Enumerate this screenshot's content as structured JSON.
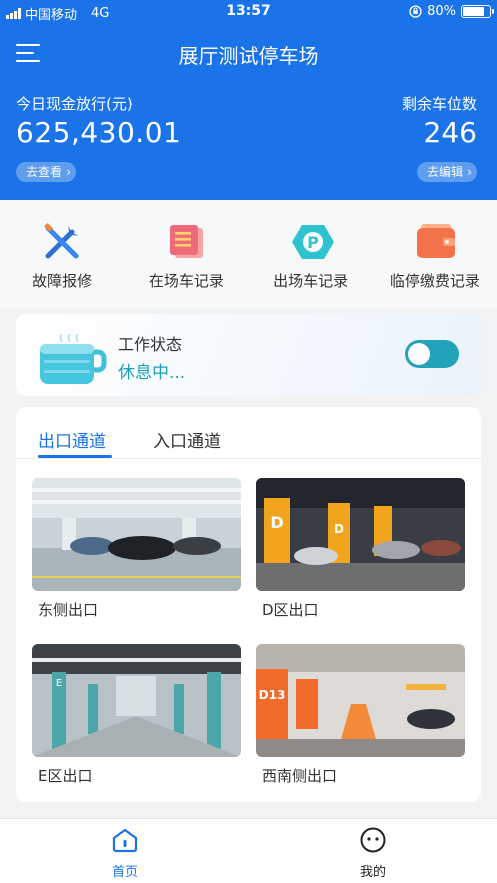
{
  "status_bar": {
    "carrier": "中国移动",
    "network": "4G",
    "time": "13:57",
    "battery": "80%",
    "battery_level": 0.8
  },
  "header": {
    "title": "展厅测试停车场"
  },
  "cash": {
    "label": "今日现金放行(元)",
    "value": "625,430.01",
    "link": "去查看"
  },
  "spots": {
    "label": "剩余车位数",
    "value": "246",
    "link": "去编辑"
  },
  "quick_actions": [
    {
      "label": "故障报修",
      "icon": "wrench-screwdriver-icon"
    },
    {
      "label": "在场车记录",
      "icon": "in-lot-record-icon"
    },
    {
      "label": "出场车记录",
      "icon": "parking-exit-icon"
    },
    {
      "label": "临停缴费记录",
      "icon": "wallet-icon"
    }
  ],
  "work_status": {
    "title": "工作状态",
    "status": "休息中...",
    "toggle_on": true
  },
  "channels": {
    "tabs": [
      "出口通道",
      "入口通道"
    ],
    "active_tab": 0,
    "items": [
      {
        "name": "东侧出口"
      },
      {
        "name": "D区出口"
      },
      {
        "name": "E区出口"
      },
      {
        "name": "西南侧出口"
      }
    ]
  },
  "tabbar": {
    "home": "首页",
    "me": "我的"
  },
  "colors": {
    "primary": "#1a73e8",
    "teal": "#23a3b9"
  }
}
